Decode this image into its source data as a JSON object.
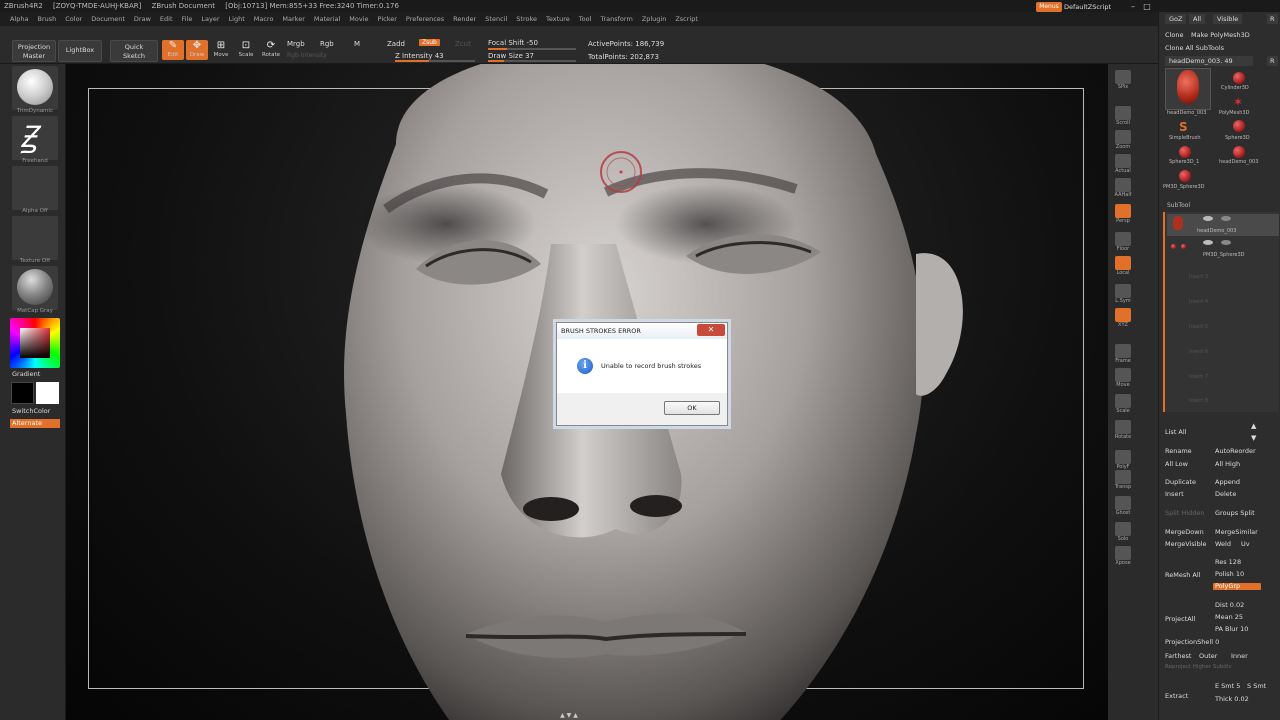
{
  "window": {
    "app": "ZBrush4R2",
    "serial": "[ZOYQ-TMDE-AUHJ-KBAR]",
    "document": "ZBrush Document",
    "stats": "[Obj:10713] Mem:855+33 Free:3240 Timer:0.176",
    "menus_label": "Menus",
    "script_label": "DefaultZScript"
  },
  "menubar": [
    "Alpha",
    "Brush",
    "Color",
    "Document",
    "Draw",
    "Edit",
    "File",
    "Layer",
    "Light",
    "Macro",
    "Marker",
    "Material",
    "Movie",
    "Picker",
    "Preferences",
    "Render",
    "Stencil",
    "Stroke",
    "Texture",
    "Tool",
    "Transform",
    "Zplugin",
    "Zscript"
  ],
  "shelf": {
    "projection_master": "Projection\nMaster",
    "lightbox": "LightBox",
    "quick_sketch": "Quick\nSketch",
    "edit": "Edit",
    "draw": "Draw",
    "move": "Move",
    "scale": "Scale",
    "rotate": "Rotate",
    "mrgb": "Mrgb",
    "rgb": "Rgb",
    "m": "M",
    "rgb_intensity": "Rgb Intensity",
    "zadd": "Zadd",
    "zsub": "Zsub",
    "zcut": "Zcut",
    "z_intensity": "Z Intensity 43",
    "z_intensity_value": 43,
    "focal_shift": "Focal Shift -50",
    "draw_size": "Draw Size 37",
    "active_points": "ActivePoints: 186,739",
    "total_points": "TotalPoints: 202,873"
  },
  "left": {
    "brush": "TrimDynamic",
    "stroke": "Freehand",
    "alpha": "Alpha Off",
    "texture": "Texture Off",
    "material": "MatCap Gray",
    "gradient": "Gradient",
    "switch_color": "SwitchColor",
    "alternate": "Alternate"
  },
  "right_shelf": [
    "SPix",
    "Scroll",
    "Zoom",
    "Actual",
    "AAHalf",
    "Persp",
    "Floor",
    "Local",
    "L.Sym",
    "XYZ",
    "Frame",
    "Move",
    "Scale",
    "Rotate",
    "PolyF",
    "Transp",
    "Ghost",
    "Solo",
    "Xpose"
  ],
  "tray": {
    "goz": "GoZ",
    "all": "All",
    "visible": "Visible",
    "r": "R",
    "clone": "Clone",
    "make_polymesh": "Make PolyMesh3D",
    "clone_all": "Clone All SubTools",
    "current_tool": "headDemo_003. 49",
    "tools": [
      "headDemo_003",
      "Cylinder3D",
      "PolyMesh3D",
      "SimpleBrush",
      "Sphere3D",
      "Sphere3D_1",
      "headDemo_003",
      "PM3D_Sphere3D"
    ],
    "subtool_title": "SubTool",
    "subtools": [
      "headDemo_003",
      "PM3D_Sphere3D"
    ],
    "empty_slots": [
      "Insert 3",
      "Insert 4",
      "Insert 5",
      "Insert 6",
      "Insert 7",
      "Insert 8"
    ],
    "list_all": "List All",
    "rename": "Rename",
    "auto_reorder": "AutoReorder",
    "all_low": "All Low",
    "all_high": "All High",
    "duplicate": "Duplicate",
    "append": "Append",
    "insert": "Insert",
    "delete": "Delete",
    "split_hidden": "Split Hidden",
    "groups_split": "Groups Split",
    "merge_down": "MergeDown",
    "merge_similar": "MergeSimilar",
    "merge_visible": "MergeVisible",
    "weld": "Weld",
    "uv": "Uv",
    "remesh_all": "ReMesh All",
    "res": "Res 128",
    "polish": "Polish 10",
    "polygrp": "PolyGrp",
    "project_all": "ProjectAll",
    "dist": "Dist 0.02",
    "mean": "Mean 25",
    "pa_blur": "PA Blur 10",
    "projection_shell": "ProjectionShell 0",
    "farthest": "Farthest",
    "outer": "Outer",
    "inner": "Inner",
    "reproject": "Reproject Higher Subdiv",
    "extract": "Extract",
    "e_smt": "E Smt 5",
    "s_smt": "S Smt",
    "thick": "Thick 0.02"
  },
  "dialog": {
    "title": "BRUSH STROKES ERROR",
    "message": "Unable to record brush strokes",
    "ok": "OK",
    "close": "✕",
    "info_icon": "i"
  },
  "colors": {
    "accent": "#e0702a",
    "primary_color": "#000000",
    "secondary_color": "#ffffff"
  }
}
